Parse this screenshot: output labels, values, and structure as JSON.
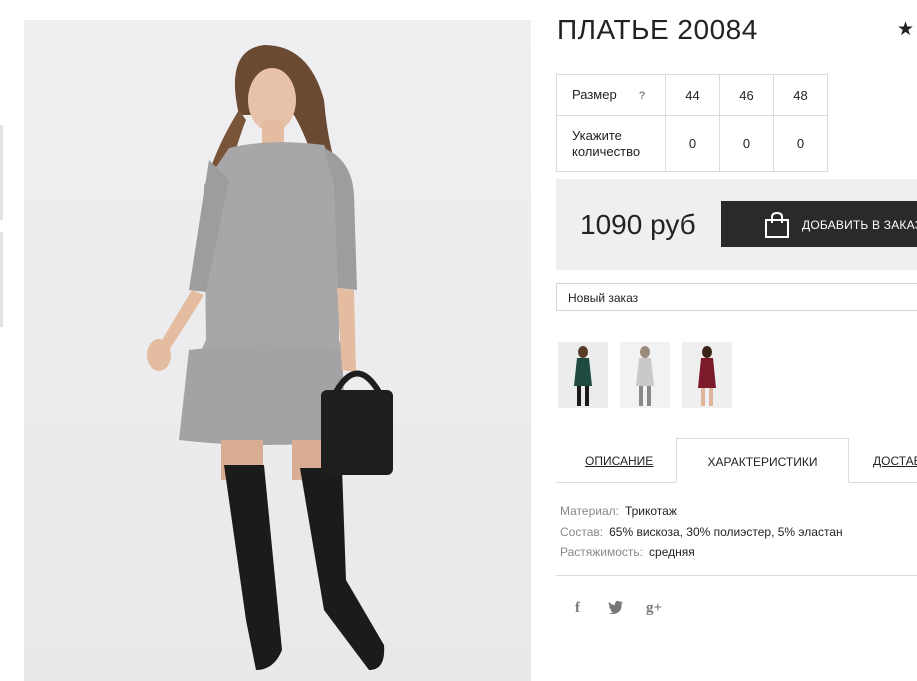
{
  "product": {
    "title": "ПЛАТЬЕ 20084",
    "favorite_icon": "star-icon"
  },
  "size_table": {
    "size_label": "Размер",
    "help_icon": "?",
    "quantity_label": "Укажите количество",
    "sizes": [
      "44",
      "46",
      "48"
    ],
    "quantities": [
      "0",
      "0",
      "0"
    ]
  },
  "purchase": {
    "price": "1090 руб",
    "add_button_label": "ДОБАВИТЬ В ЗАКАЗ",
    "button_icon": "shopping-bag-icon"
  },
  "order": {
    "selected": "Новый заказ"
  },
  "color_variants": [
    "dark-green",
    "light-grey",
    "burgundy"
  ],
  "tabs": [
    "ОПИСАНИЕ",
    "ХАРАКТЕРИСТИКИ",
    "ДОСТАВКА"
  ],
  "characteristics": [
    {
      "label": "Материал:",
      "value": "Трикотаж"
    },
    {
      "label": "Состав:",
      "value": "65% вискоза, 30% полиэстер, 5% эластан"
    },
    {
      "label": "Растяжимость:",
      "value": "средняя"
    }
  ],
  "social": {
    "facebook": "f",
    "twitter": "🐦",
    "googleplus": "g+"
  },
  "colors": {
    "button_bg": "#2a2a2a",
    "price_bg": "#efefef",
    "text": "#222222"
  }
}
